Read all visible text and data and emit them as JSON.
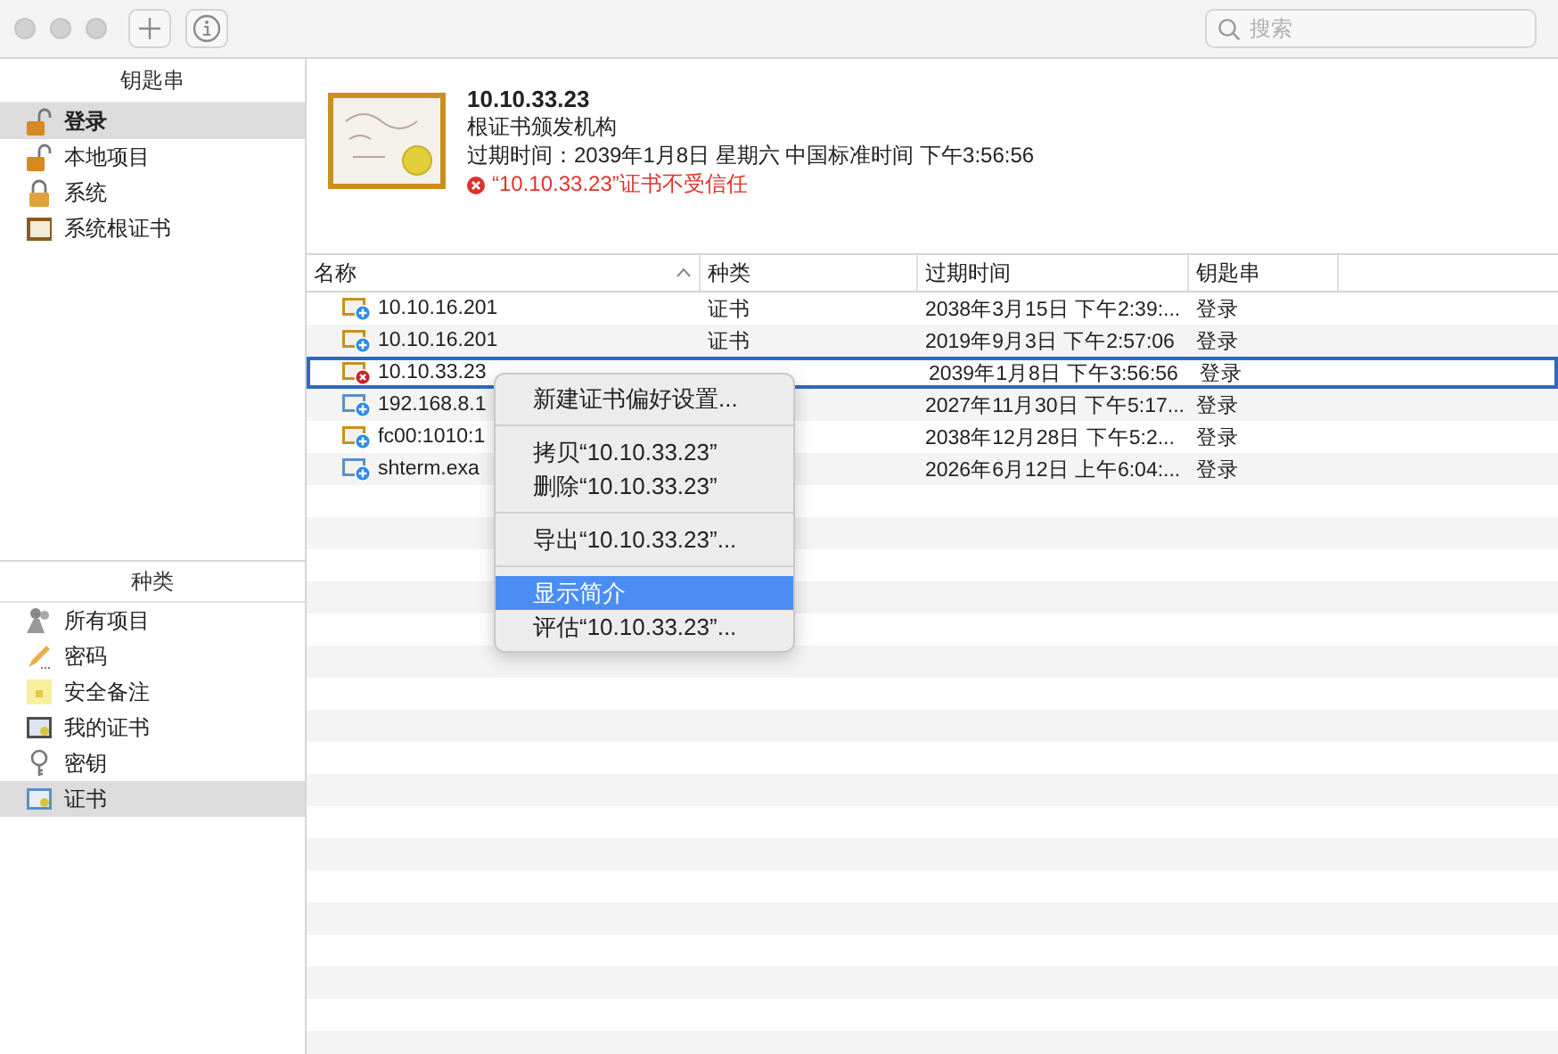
{
  "toolbar": {
    "search": {
      "placeholder": "搜索"
    }
  },
  "sidebar": {
    "keychains": {
      "header": "钥匙串",
      "items": [
        {
          "label": "登录",
          "kind": "open-lock",
          "selected": true
        },
        {
          "label": "本地项目",
          "kind": "open-lock",
          "selected": false
        },
        {
          "label": "系统",
          "kind": "lock",
          "selected": false
        },
        {
          "label": "系统根证书",
          "kind": "cabinet",
          "selected": false
        }
      ]
    },
    "categories": {
      "header": "种类",
      "items": [
        {
          "label": "所有项目",
          "kind": "people",
          "selected": false
        },
        {
          "label": "密码",
          "kind": "pencil",
          "selected": false
        },
        {
          "label": "安全备注",
          "kind": "note",
          "selected": false
        },
        {
          "label": "我的证书",
          "kind": "mycert",
          "selected": false
        },
        {
          "label": "密钥",
          "kind": "key",
          "selected": false
        },
        {
          "label": "证书",
          "kind": "cert",
          "selected": true
        }
      ]
    }
  },
  "detail": {
    "title": "10.10.33.23",
    "subtitle": "根证书颁发机构",
    "expiry": "过期时间：2039年1月8日 星期六 中国标准时间 下午3:56:56",
    "warning": "“10.10.33.23”证书不受信任"
  },
  "table": {
    "columns": [
      "名称",
      "种类",
      "过期时间",
      "钥匙串"
    ],
    "rows": [
      {
        "name": "10.10.16.201",
        "type": "证书",
        "expires": "2038年3月15日 下午2:39:...",
        "keychain": "登录",
        "kind": "root",
        "trusted": true,
        "selected": false
      },
      {
        "name": "10.10.16.201",
        "type": "证书",
        "expires": "2019年9月3日 下午2:57:06",
        "keychain": "登录",
        "kind": "root",
        "trusted": true,
        "selected": false
      },
      {
        "name": "10.10.33.23",
        "expires": "2039年1月8日 下午3:56:56",
        "keychain": "登录",
        "kind": "root",
        "trusted": false,
        "selected": true
      },
      {
        "name": "192.168.8.1",
        "expires": "2027年11月30日 下午5:17...",
        "keychain": "登录",
        "kind": "leaf",
        "trusted": true,
        "selected": false
      },
      {
        "name": "fc00:1010:1",
        "expires": "2038年12月28日 下午5:2...",
        "keychain": "登录",
        "kind": "root",
        "trusted": true,
        "selected": false
      },
      {
        "name": "shterm.exa",
        "expires": "2026年6月12日 上午6:04:...",
        "keychain": "登录",
        "kind": "leaf",
        "trusted": true,
        "selected": false
      }
    ]
  },
  "context_menu": {
    "groups": [
      [
        {
          "label": "新建证书偏好设置...",
          "selected": false
        }
      ],
      [
        {
          "label": "拷贝“10.10.33.23”",
          "selected": false
        },
        {
          "label": "删除“10.10.33.23”",
          "selected": false
        }
      ],
      [
        {
          "label": "导出“10.10.33.23”...",
          "selected": false
        }
      ],
      [
        {
          "label": "显示简介",
          "selected": true
        },
        {
          "label": "评估“10.10.33.23”...",
          "selected": false
        }
      ]
    ]
  }
}
